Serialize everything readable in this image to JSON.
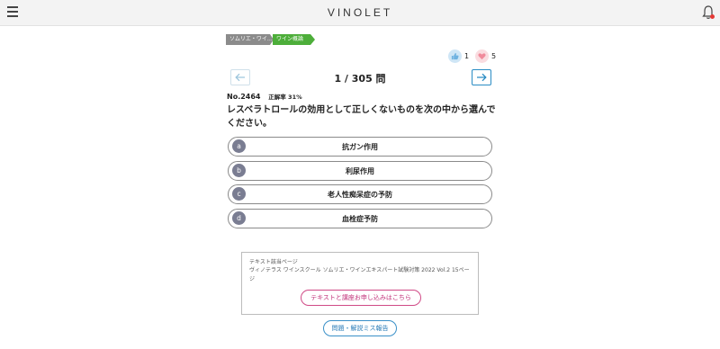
{
  "header": {
    "logo": "VINOLET"
  },
  "breadcrumb": {
    "items": [
      "ソムリエ・ワイ…",
      "ワイン概論"
    ]
  },
  "reactions": {
    "like_count": "1",
    "heart_count": "5"
  },
  "quiz": {
    "counter": "1 / 305 問",
    "number": "No.2464",
    "correct_rate": "正解率 31%",
    "question": "レスベラトロールの効用として正しくないものを次の中から選んでください。",
    "options": [
      {
        "letter": "a",
        "text": "抗ガン作用"
      },
      {
        "letter": "b",
        "text": "利尿作用"
      },
      {
        "letter": "c",
        "text": "老人性痴呆症の予防"
      },
      {
        "letter": "d",
        "text": "血栓症予防"
      }
    ]
  },
  "info": {
    "label": "テキスト該当ページ",
    "text": "ヴィノテラス ワインスクール ソムリエ・ワインエキスパート試験対策 2022 Vol.2 15ページ",
    "apply_button": "テキストと講座お申し込みはこちら"
  },
  "report_button": "問題・解説ミス報告",
  "colors": {
    "breadcrumb_gray": "#8b8b8b",
    "breadcrumb_green": "#4dae3a",
    "nav_blue": "#2a8cc4",
    "option_letter_bg": "#7a7d92",
    "apply_pink": "#c2327a",
    "bell_dot": "#e53935"
  },
  "icons": {
    "menu": "hamburger-icon",
    "notification": "bell-icon",
    "like": "thumbs-up-icon",
    "heart": "heart-icon",
    "prev": "arrow-left-icon",
    "next": "arrow-right-icon"
  }
}
